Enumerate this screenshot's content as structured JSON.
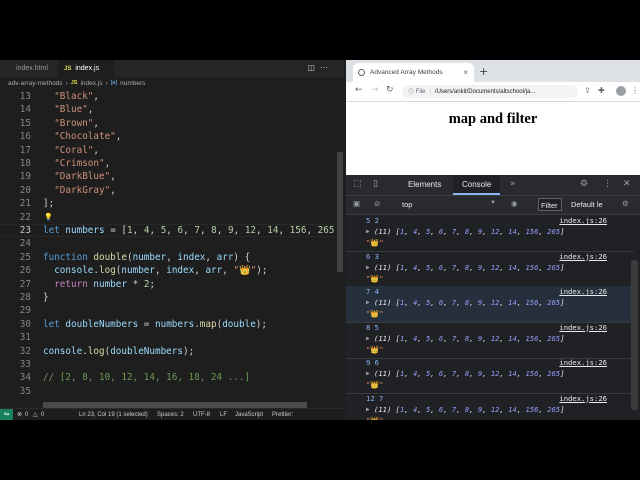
{
  "vscode": {
    "tabs": [
      {
        "label": "index.html",
        "active": false
      },
      {
        "label": "index.js",
        "active": true,
        "icon": "JS"
      }
    ],
    "breadcrumb": [
      "adv-array-methods",
      "JS",
      "index.js",
      "numbers"
    ],
    "lines": [
      {
        "n": "13",
        "code": "  \"Black\","
      },
      {
        "n": "14",
        "code": "  \"Blue\","
      },
      {
        "n": "15",
        "code": "  \"Brown\","
      },
      {
        "n": "16",
        "code": "  \"Chocolate\","
      },
      {
        "n": "17",
        "code": "  \"Coral\","
      },
      {
        "n": "18",
        "code": "  \"Crimson\","
      },
      {
        "n": "19",
        "code": "  \"DarkBlue\","
      },
      {
        "n": "20",
        "code": "  \"DarkGray\","
      },
      {
        "n": "21",
        "code": "];"
      },
      {
        "n": "22",
        "code": ""
      },
      {
        "n": "23",
        "code": "let numbers = [1, 4, 5, 6, 7, 8, 9, 12, 14, 156, 265];"
      },
      {
        "n": "24",
        "code": ""
      },
      {
        "n": "25",
        "code": "function double(number, index, arr) {"
      },
      {
        "n": "26",
        "code": "  console.log(number, index, arr, \"👑\");"
      },
      {
        "n": "27",
        "code": "  return number * 2;"
      },
      {
        "n": "28",
        "code": "}"
      },
      {
        "n": "29",
        "code": ""
      },
      {
        "n": "30",
        "code": "let doubleNumbers = numbers.map(double);"
      },
      {
        "n": "31",
        "code": ""
      },
      {
        "n": "32",
        "code": "console.log(doubleNumbers);"
      },
      {
        "n": "33",
        "code": ""
      },
      {
        "n": "34",
        "code": "// [2, 8, 10, 12, 14, 16, 18, 24 ...]"
      },
      {
        "n": "35",
        "code": ""
      }
    ],
    "status": {
      "errors": "0",
      "warnings": "0",
      "position": "Ln 23, Col 19 (1 selected)",
      "spaces": "Spaces: 2",
      "encoding": "UTF-8",
      "eol": "LF",
      "language": "JavaScript",
      "formatter": "Prettier:"
    }
  },
  "chrome": {
    "tab_title": "Advanced Array Methods",
    "omnibox_label": "File",
    "url": "/Users/ankit/Documents/altschool/ja...",
    "page_heading": "map and filter",
    "devtools": {
      "tabs": [
        "Elements",
        "Console"
      ],
      "active_tab": "Console",
      "context": "top",
      "filter_placeholder": "Filter",
      "levels": "Default le",
      "entries": [
        {
          "head": "5 2",
          "src": "index.js:26",
          "array": "[1, 4, 5, 6, 7, 8, 9, 12, 14, 156, 265]",
          "len": "(11)",
          "crown": "\"👑\""
        },
        {
          "head": "6 3",
          "src": "index.js:26",
          "array": "[1, 4, 5, 6, 7, 8, 9, 12, 14, 156, 265]",
          "len": "(11)",
          "crown": "\"👑\""
        },
        {
          "head": "7 4",
          "src": "index.js:26",
          "array": "[1, 4, 5, 6, 7, 8, 9, 12, 14, 156, 265]",
          "len": "(11)",
          "crown": "\"👑\""
        },
        {
          "head": "8 5",
          "src": "index.js:26",
          "array": "[1, 4, 5, 6, 7, 8, 9, 12, 14, 156, 265]",
          "len": "(11)",
          "crown": "\"👑\""
        },
        {
          "head": "9 6",
          "src": "index.js:26",
          "array": "[1, 4, 5, 6, 7, 8, 9, 12, 14, 156, 265]",
          "len": "(11)",
          "crown": "\"👑\""
        },
        {
          "head": "12 7",
          "src": "index.js:26",
          "array": "[1, 4, 5, 6, 7, 8, 9, 12, 14, 156, 265]",
          "len": "(11)",
          "crown": "\"👑\""
        }
      ]
    }
  },
  "colors": {
    "accent": "#8ab4f8",
    "remote": "#16825d",
    "editor_bg": "#1e1e1e"
  }
}
